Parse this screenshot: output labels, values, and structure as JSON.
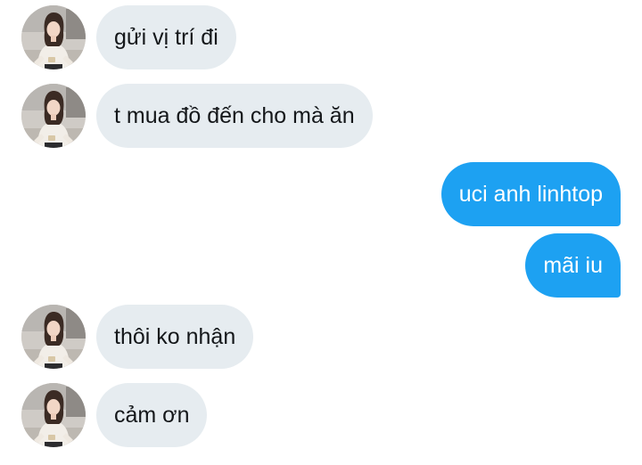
{
  "messages": [
    {
      "side": "in",
      "text": "gửi vị trí đi"
    },
    {
      "side": "in",
      "text": "t mua đồ đến cho mà ăn"
    },
    {
      "side": "out",
      "text": "uci anh linhtop"
    },
    {
      "side": "out",
      "text": "mãi iu"
    },
    {
      "side": "in",
      "text": "thôi ko nhận"
    },
    {
      "side": "in",
      "text": "cảm ơn"
    }
  ],
  "colors": {
    "incoming_bubble": "#e6ecf0",
    "outgoing_bubble": "#1da1f2",
    "incoming_text": "#14171a",
    "outgoing_text": "#ffffff"
  }
}
